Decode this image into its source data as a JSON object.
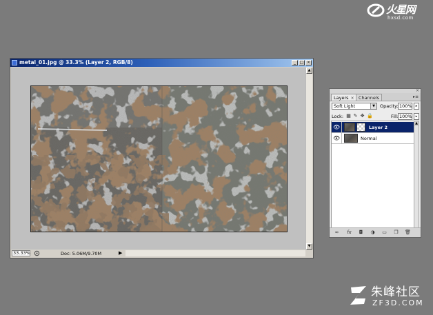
{
  "logos": {
    "top": {
      "cn": "火星网",
      "en": "hxsd.com"
    },
    "bottom": {
      "cn": "朱峰社区",
      "en": "ZF3D.COM"
    }
  },
  "document": {
    "title": "metal_01.jpg @ 33.3% (Layer 2, RGB/8)",
    "buttons": {
      "minimize": "_",
      "maximize": "□",
      "close": "×"
    },
    "scroll_up": "▲",
    "scroll_down": "▼",
    "status": {
      "zoom": "33.33%",
      "doc_info": "Doc: 5.06M/9.70M",
      "arrow": "▶"
    }
  },
  "layers_panel": {
    "close_glyph": "×",
    "tabs": [
      {
        "label": "Layers",
        "close": "×",
        "active": true
      },
      {
        "label": "Channels",
        "active": false
      }
    ],
    "menu_glyph": "▸≡",
    "blend_mode": "Soft Light",
    "opacity_label": "Opacity:",
    "opacity_value": "100%",
    "lock_label": "Lock:",
    "fill_label": "Fill:",
    "fill_value": "100%",
    "layers": [
      {
        "name": "Layer 2",
        "selected": true
      },
      {
        "name": "Normal",
        "selected": false
      }
    ],
    "icons": {
      "eye": "👁",
      "dropdown": "▼",
      "arrow": "▸",
      "lock_transparent": "▦",
      "lock_paint": "✎",
      "lock_move": "✥",
      "lock_all": "🔒",
      "link": "∞",
      "fx": "fx",
      "mask": "◘",
      "adjust": "◑",
      "group": "▭",
      "new_layer": "❐",
      "trash": "🗑"
    }
  },
  "colors": {
    "background": "#7b7b7b",
    "title_bar": "#0a246a",
    "selected_layer": "#0a246a",
    "canvas_bg": "#c0c0c0"
  }
}
